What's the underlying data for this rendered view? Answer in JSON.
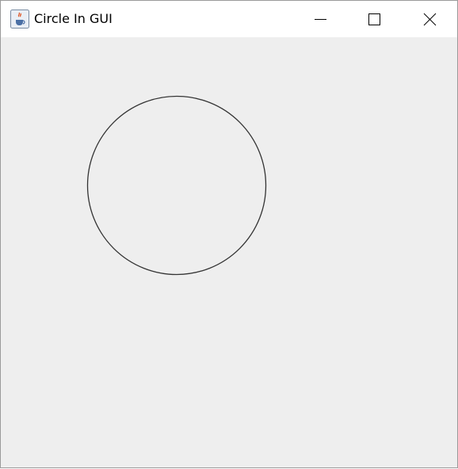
{
  "window": {
    "title": "Circle In GUI",
    "app_icon": "java-coffee-cup-icon",
    "controls": {
      "minimize": "minimize-icon",
      "maximize": "maximize-icon",
      "close": "close-icon"
    }
  },
  "colors": {
    "titlebar_bg": "#ffffff",
    "client_bg": "#eeeeee",
    "circle_stroke": "#333333",
    "border": "#9a9a9a"
  }
}
